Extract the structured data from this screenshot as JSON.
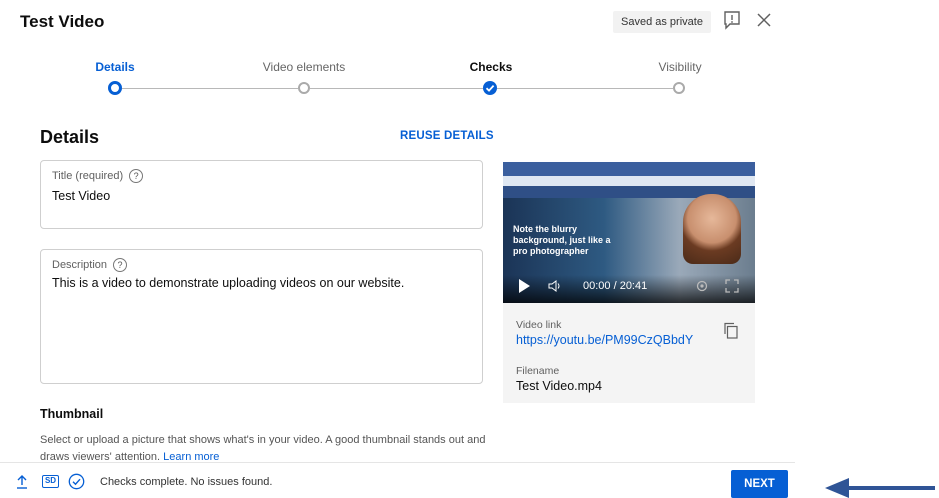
{
  "dialog": {
    "title": "Test Video",
    "saved_status": "Saved as private"
  },
  "stepper": {
    "steps": [
      {
        "label": "Details",
        "state": "current"
      },
      {
        "label": "Video elements",
        "state": "future"
      },
      {
        "label": "Checks",
        "state": "checked"
      },
      {
        "label": "Visibility",
        "state": "future"
      }
    ]
  },
  "details": {
    "heading": "Details",
    "reuse_label": "REUSE DETAILS",
    "title_field": {
      "label": "Title (required)",
      "value": "Test Video"
    },
    "description_field": {
      "label": "Description",
      "value": "This is a video to demonstrate uploading videos on our website."
    },
    "thumbnail": {
      "heading": "Thumbnail",
      "description": "Select or upload a picture that shows what's in your video. A good thumbnail stands out and draws viewers' attention.",
      "learn_more": "Learn more"
    }
  },
  "preview": {
    "caption": "Note the blurry background, just like a pro photographer",
    "time": "00:00 / 20:41",
    "video_link_label": "Video link",
    "video_link": "https://youtu.be/PM99CzQBbdY",
    "filename_label": "Filename",
    "filename": "Test Video.mp4"
  },
  "footer": {
    "quality_badge": "SD",
    "status_text": "Checks complete. No issues found.",
    "next_label": "NEXT"
  },
  "colors": {
    "accent": "#065fd4",
    "arrow": "#2f5496"
  },
  "icons": [
    "feedback-icon",
    "close-icon",
    "help-icon",
    "play-icon",
    "volume-icon",
    "settings-icon",
    "fullscreen-icon",
    "copy-icon",
    "upload-icon",
    "check-circle-icon",
    "arrow-left-icon"
  ]
}
